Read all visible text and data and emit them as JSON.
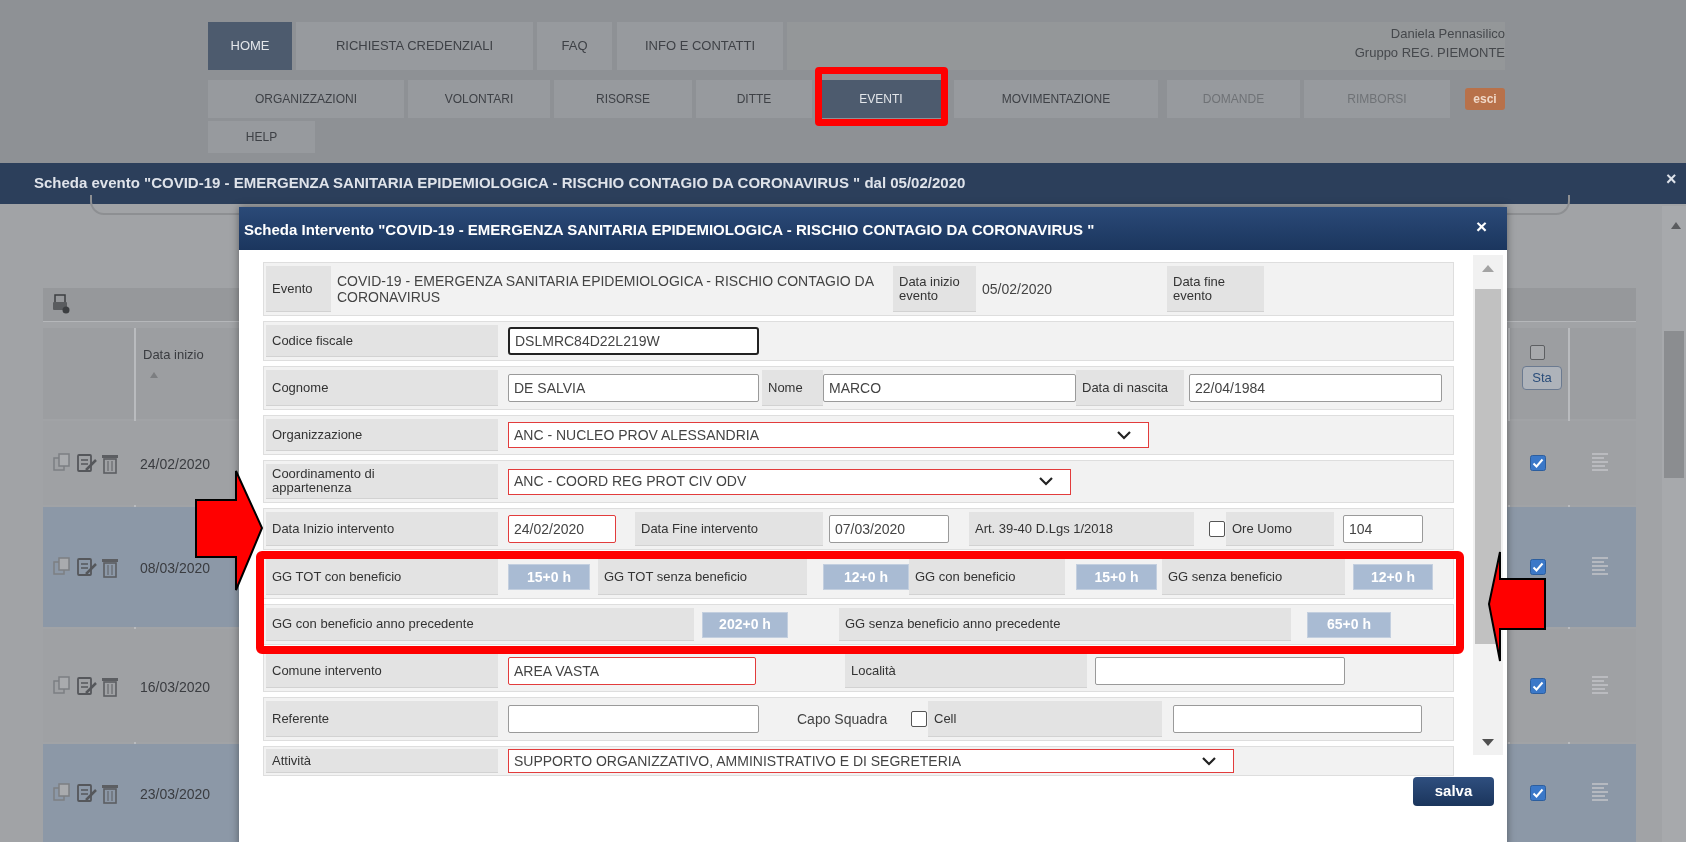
{
  "top_nav": {
    "primary": [
      {
        "label": "HOME",
        "selected": true
      },
      {
        "label": "RICHIESTA CREDENZIALI",
        "selected": false
      },
      {
        "label": "FAQ",
        "selected": false
      },
      {
        "label": "INFO E CONTATTI",
        "selected": false
      }
    ],
    "secondary": [
      {
        "label": "ORGANIZZAZIONI",
        "selected": false,
        "disabled": false
      },
      {
        "label": "VOLONTARI",
        "selected": false,
        "disabled": false
      },
      {
        "label": "RISORSE",
        "selected": false,
        "disabled": false
      },
      {
        "label": "DITTE",
        "selected": false,
        "disabled": false
      },
      {
        "label": "EVENTI",
        "selected": true,
        "disabled": false
      },
      {
        "label": "MOVIMENTAZIONE",
        "selected": false,
        "disabled": false
      },
      {
        "label": "DOMANDE",
        "selected": false,
        "disabled": true
      },
      {
        "label": "RIMBORSI",
        "selected": false,
        "disabled": true
      }
    ],
    "logout": "esci",
    "help": "HELP",
    "user": {
      "name": "Daniela Pennasilico",
      "group": "Gruppo REG. PIEMONTE"
    }
  },
  "background_window": {
    "title": "Scheda evento \"COVID-19 - EMERGENZA SANITARIA EPIDEMIOLOGICA - RISCHIO CONTAGIO DA CORONAVIRUS \" dal 05/02/2020",
    "close": "×",
    "table": {
      "columns": [
        "Data inizio",
        "Sta"
      ],
      "header_checked": false,
      "rows": [
        {
          "date": "24/02/2020",
          "checked": true
        },
        {
          "date": "08/03/2020",
          "checked": true
        },
        {
          "date": "16/03/2020",
          "checked": true
        },
        {
          "date": "23/03/2020",
          "checked": true
        }
      ]
    }
  },
  "modal": {
    "title": "Scheda Intervento \"COVID-19 - EMERGENZA SANITARIA EPIDEMIOLOGICA - RISCHIO CONTAGIO DA CORONAVIRUS \"",
    "close": "×",
    "save": "salva",
    "rows": [
      {
        "fields": [
          {
            "kind": "label",
            "text": "Evento"
          },
          {
            "kind": "text",
            "text": "COVID-19 - EMERGENZA SANITARIA EPIDEMIOLOGICA - RISCHIO CONTAGIO DA CORONAVIRUS"
          },
          {
            "kind": "label",
            "text": "Data inizio evento"
          },
          {
            "kind": "text",
            "text": "05/02/2020"
          },
          {
            "kind": "label",
            "text": "Data fine evento"
          }
        ]
      },
      {
        "fields": [
          {
            "kind": "label",
            "text": "Codice fiscale"
          },
          {
            "kind": "input",
            "value": "DSLMRC84D22L219W",
            "required": false,
            "focused": true
          }
        ]
      },
      {
        "fields": [
          {
            "kind": "label",
            "text": "Cognome"
          },
          {
            "kind": "input",
            "value": "DE SALVIA",
            "required": false,
            "focused": false
          },
          {
            "kind": "label",
            "text": "Nome"
          },
          {
            "kind": "input",
            "value": "MARCO",
            "required": false,
            "focused": false
          },
          {
            "kind": "label",
            "text": "Data di nascita"
          },
          {
            "kind": "input",
            "value": "22/04/1984",
            "required": false,
            "focused": false
          }
        ]
      },
      {
        "fields": [
          {
            "kind": "label",
            "text": "Organizzazione"
          },
          {
            "kind": "select",
            "value": "ANC - NUCLEO PROV ALESSANDRIA",
            "required": true
          }
        ]
      },
      {
        "fields": [
          {
            "kind": "label",
            "text": "Coordinamento di appartenenza"
          },
          {
            "kind": "select",
            "value": "ANC - COORD REG PROT CIV ODV",
            "required": true
          }
        ]
      },
      {
        "fields": [
          {
            "kind": "label",
            "text": "Data Inizio intervento"
          },
          {
            "kind": "input",
            "value": "24/02/2020",
            "required": true,
            "focused": false
          },
          {
            "kind": "label",
            "text": "Data Fine intervento"
          },
          {
            "kind": "input",
            "value": "07/03/2020",
            "required": false,
            "focused": false
          },
          {
            "kind": "label",
            "text": "Art. 39-40 D.Lgs 1/2018"
          },
          {
            "kind": "checkbox",
            "checked": false
          },
          {
            "kind": "label",
            "text": "Ore Uomo"
          },
          {
            "kind": "input",
            "value": "104",
            "required": false,
            "focused": false
          }
        ]
      },
      {
        "fields": [
          {
            "kind": "label",
            "text": "GG TOT con beneficio"
          },
          {
            "kind": "badge",
            "text": "15+0 h"
          },
          {
            "kind": "label",
            "text": "GG TOT senza beneficio"
          },
          {
            "kind": "badge",
            "text": "12+0 h"
          },
          {
            "kind": "label",
            "text": "GG con beneficio"
          },
          {
            "kind": "badge",
            "text": "15+0 h"
          },
          {
            "kind": "label",
            "text": "GG senza beneficio"
          },
          {
            "kind": "badge",
            "text": "12+0 h"
          }
        ]
      },
      {
        "fields": [
          {
            "kind": "label",
            "text": "GG con beneficio anno precedente"
          },
          {
            "kind": "badge",
            "text": "202+0 h"
          },
          {
            "kind": "label",
            "text": "GG senza beneficio anno precedente"
          },
          {
            "kind": "badge",
            "text": "65+0 h"
          }
        ]
      },
      {
        "fields": [
          {
            "kind": "label",
            "text": "Comune intervento"
          },
          {
            "kind": "input",
            "value": "AREA VASTA",
            "required": true,
            "focused": false
          },
          {
            "kind": "label",
            "text": "Località"
          },
          {
            "kind": "input",
            "required": false,
            "focused": false
          }
        ]
      },
      {
        "fields": [
          {
            "kind": "label",
            "text": "Referente"
          },
          {
            "kind": "input",
            "required": false,
            "focused": false
          },
          {
            "kind": "text",
            "text": "Capo Squadra"
          },
          {
            "kind": "checkbox",
            "checked": false
          },
          {
            "kind": "label",
            "text": "Cell"
          },
          {
            "kind": "input",
            "required": false,
            "focused": false
          }
        ]
      },
      {
        "fields": [
          {
            "kind": "label",
            "text": "Attività"
          },
          {
            "kind": "select",
            "value": "SUPPORTO ORGANIZZATIVO, AMMINISTRATIVO E DI SEGRETERIA",
            "required": true
          }
        ]
      }
    ]
  }
}
